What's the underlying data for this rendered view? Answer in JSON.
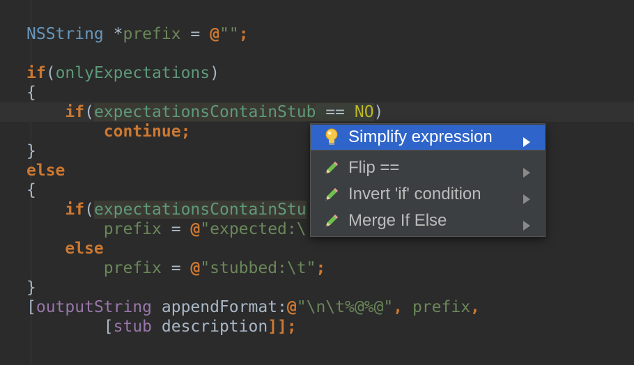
{
  "code": {
    "line1": {
      "type": "NSString",
      "star": " *",
      "name": "prefix",
      "eq": " = ",
      "at": "@",
      "str": "\"\"",
      "semi": ";"
    },
    "line2": {
      "kw": "if",
      "paren_open": "(",
      "var": "onlyExpectations",
      "paren_close": ")"
    },
    "line3": {
      "text": "{"
    },
    "line4": {
      "indent": "    ",
      "kw": "if",
      "paren_open": "(",
      "var": "expectationsContainStub",
      "op": " == ",
      "const": "NO",
      "paren_close": ")"
    },
    "line5": {
      "indent": "        ",
      "kw": "continue",
      "semi": ";"
    },
    "line6": {
      "text": "}"
    },
    "line7": {
      "kw": "else"
    },
    "line8": {
      "text": "{"
    },
    "line9": {
      "indent": "    ",
      "kw": "if",
      "paren_open": "(",
      "var": "expectationsContainStu"
    },
    "line10": {
      "indent": "        ",
      "name": "prefix",
      "eq": " = ",
      "at": "@",
      "str": "\"expected:\\"
    },
    "line11": {
      "indent": "    ",
      "kw": "else"
    },
    "line12": {
      "indent": "        ",
      "name": "prefix",
      "eq": " = ",
      "at": "@",
      "str": "\"stubbed:\\t\"",
      "semi": ";"
    },
    "line13": {
      "text": "}"
    },
    "line14": {
      "open": "[",
      "recv": "outputString",
      "msg": " appendFormat:",
      "at": "@",
      "str": "\"\\n\\t%@%@\"",
      "rest": ", ",
      "arg": "prefix",
      "comma": ","
    },
    "line15": {
      "indent": "        ",
      "open": "[",
      "recv": "stub",
      "msg": " description",
      "close": "]];"
    }
  },
  "popup": {
    "items": [
      {
        "label": "Simplify expression",
        "icon": "lightbulb-icon",
        "selected": true
      },
      {
        "label": "Flip ==",
        "icon": "pencil-icon",
        "selected": false
      },
      {
        "label": "Invert 'if' condition",
        "icon": "pencil-icon",
        "selected": false
      },
      {
        "label": "Merge If Else",
        "icon": "pencil-icon",
        "selected": false
      }
    ]
  },
  "colors": {
    "background": "#2b2b2b",
    "keyword": "#cc7832",
    "string": "#6a8759",
    "type": "#6897bb",
    "ivar": "#9876aa",
    "selection": "#2f65ca"
  }
}
